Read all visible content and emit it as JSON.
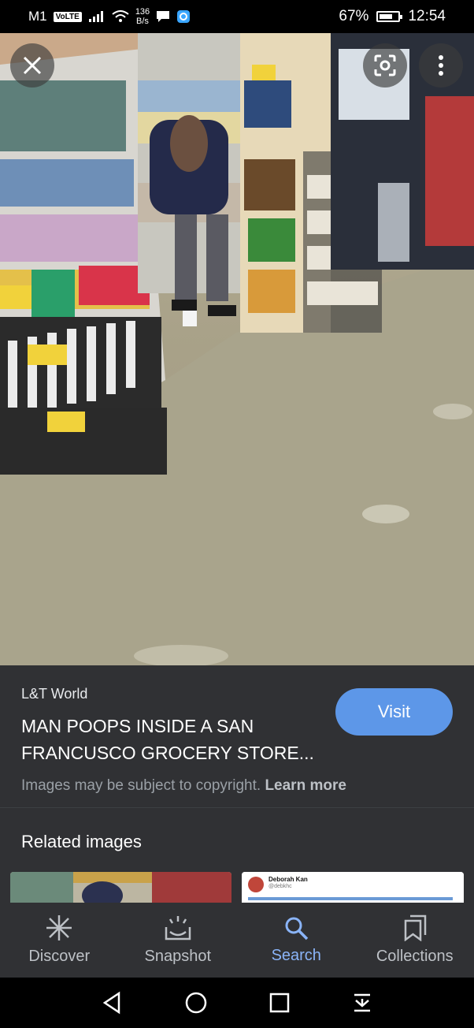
{
  "status_bar": {
    "carrier": "M1",
    "volte": "VoLTE",
    "speed_value": "136",
    "speed_unit": "B/s",
    "battery": "67%",
    "time": "12:54"
  },
  "image_viewer": {
    "close_icon": "close-icon",
    "lens_icon": "lens-icon",
    "more_icon": "more-vert-icon"
  },
  "result": {
    "source": "L&T World",
    "title": "MAN POOPS INSIDE A SAN FRANCUSCO GROCERY STORE...",
    "visit_label": "Visit",
    "copyright_text": "Images may be subject to copyright.",
    "learn_more": "Learn more"
  },
  "related": {
    "title": "Related images",
    "tweet_name": "Deborah Kan",
    "tweet_handle": "@debkhc"
  },
  "bottom_nav": {
    "items": [
      {
        "label": "Discover",
        "icon": "asterisk-icon",
        "active": false
      },
      {
        "label": "Snapshot",
        "icon": "snapshot-icon",
        "active": false
      },
      {
        "label": "Search",
        "icon": "search-icon",
        "active": true
      },
      {
        "label": "Collections",
        "icon": "collections-icon",
        "active": false
      }
    ]
  },
  "colors": {
    "accent": "#8ab4f8",
    "visit_button": "#5d97e8",
    "panel": "#303134"
  }
}
